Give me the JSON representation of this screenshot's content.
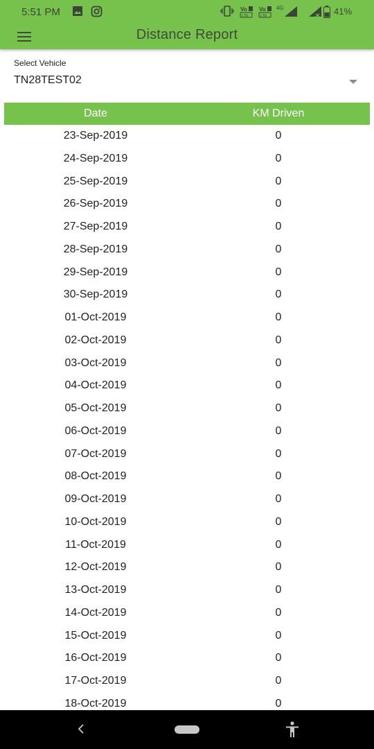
{
  "status_bar": {
    "time": "5:51 PM",
    "battery": "41%",
    "network": "4G",
    "icons": [
      "image-icon",
      "instagram-icon",
      "vibrate-icon",
      "volte-icon",
      "volte-icon",
      "signal-icon",
      "signal-icon",
      "battery-icon"
    ]
  },
  "app_bar": {
    "title": "Distance Report",
    "menu_icon": "hamburger-menu-icon"
  },
  "vehicle_select": {
    "label": "Select Vehicle",
    "value": "TN28TEST02"
  },
  "table": {
    "headers": [
      "Date",
      "KM Driven"
    ],
    "rows": [
      {
        "date": "23-Sep-2019",
        "km": "0"
      },
      {
        "date": "24-Sep-2019",
        "km": "0"
      },
      {
        "date": "25-Sep-2019",
        "km": "0"
      },
      {
        "date": "26-Sep-2019",
        "km": "0"
      },
      {
        "date": "27-Sep-2019",
        "km": "0"
      },
      {
        "date": "28-Sep-2019",
        "km": "0"
      },
      {
        "date": "29-Sep-2019",
        "km": "0"
      },
      {
        "date": "30-Sep-2019",
        "km": "0"
      },
      {
        "date": "01-Oct-2019",
        "km": "0"
      },
      {
        "date": "02-Oct-2019",
        "km": "0"
      },
      {
        "date": "03-Oct-2019",
        "km": "0"
      },
      {
        "date": "04-Oct-2019",
        "km": "0"
      },
      {
        "date": "05-Oct-2019",
        "km": "0"
      },
      {
        "date": "06-Oct-2019",
        "km": "0"
      },
      {
        "date": "07-Oct-2019",
        "km": "0"
      },
      {
        "date": "08-Oct-2019",
        "km": "0"
      },
      {
        "date": "09-Oct-2019",
        "km": "0"
      },
      {
        "date": "10-Oct-2019",
        "km": "0"
      },
      {
        "date": "11-Oct-2019",
        "km": "0"
      },
      {
        "date": "12-Oct-2019",
        "km": "0"
      },
      {
        "date": "13-Oct-2019",
        "km": "0"
      },
      {
        "date": "14-Oct-2019",
        "km": "0"
      },
      {
        "date": "15-Oct-2019",
        "km": "0"
      },
      {
        "date": "16-Oct-2019",
        "km": "0"
      },
      {
        "date": "17-Oct-2019",
        "km": "0"
      },
      {
        "date": "18-Oct-2019",
        "km": "0"
      }
    ]
  },
  "nav_bar": {
    "icons": [
      "back-icon",
      "home-pill-icon",
      "accessibility-icon"
    ]
  },
  "colors": {
    "accent": "#77c24d",
    "title_text": "#3f4a3a",
    "header_text": "#ffffff",
    "nav_bar": "#000000"
  }
}
